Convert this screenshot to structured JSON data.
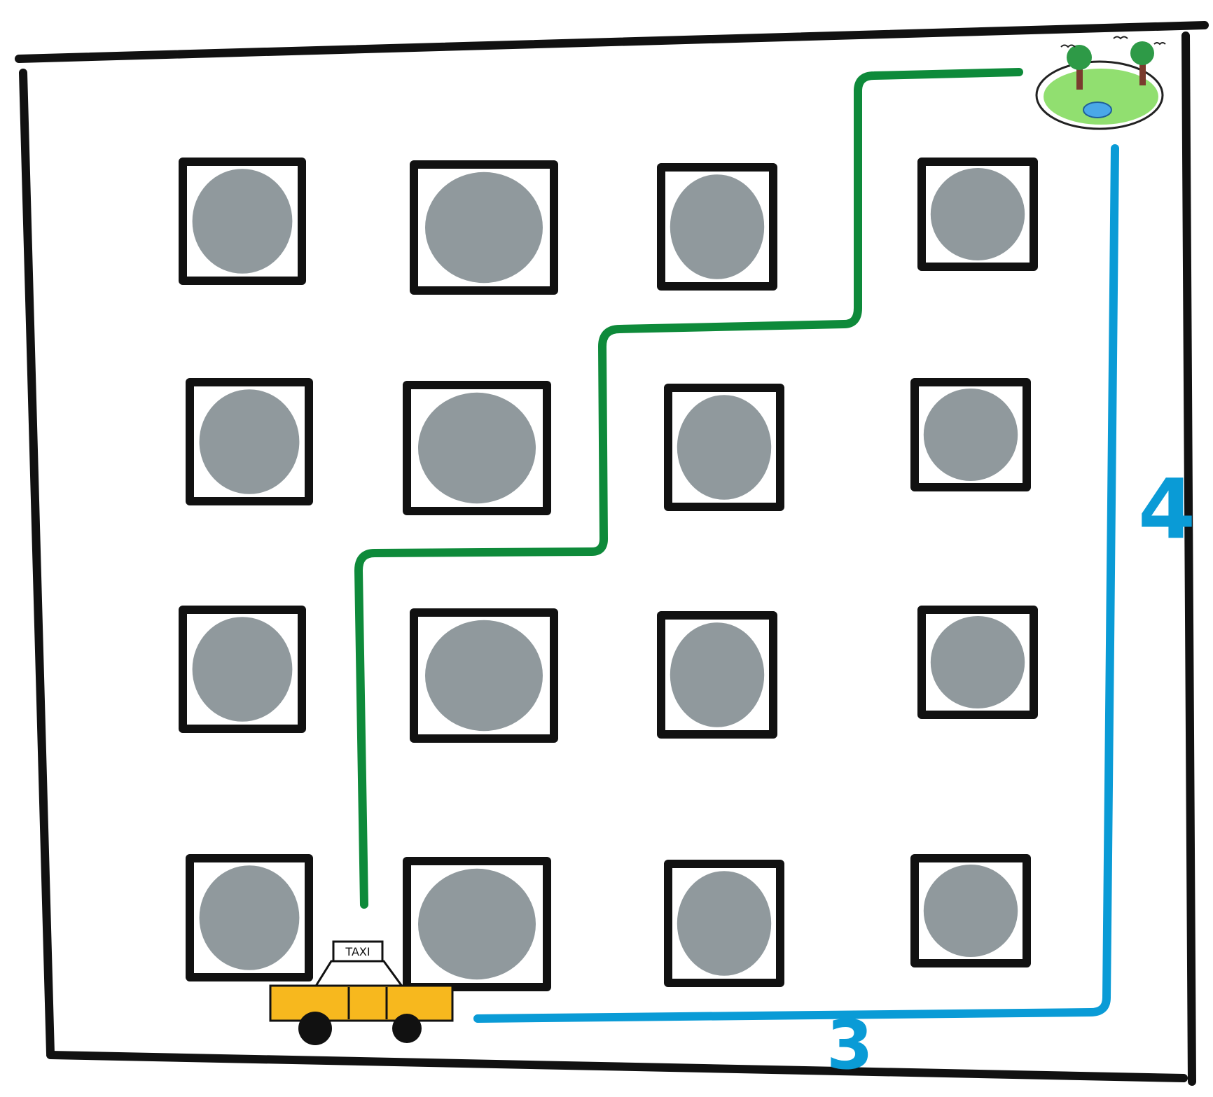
{
  "diagram": {
    "grid_rows": 4,
    "grid_cols": 4,
    "route_labels": {
      "up": "4",
      "across": "3"
    },
    "taxi_sign": "TAXI",
    "colors": {
      "background": "#ffffff",
      "outline": "#111111",
      "block_fill": "#8a9498",
      "green_route": "#0e8a3a",
      "blue_route": "#0a9bd6",
      "taxi_body": "#f7b81e",
      "park_grass": "#7ed957",
      "park_water": "#4aa8e8",
      "tree_trunk": "#7a3b2e",
      "tree_leaves": "#2e9a47"
    },
    "icons": [
      "taxi-icon",
      "park-icon"
    ]
  }
}
